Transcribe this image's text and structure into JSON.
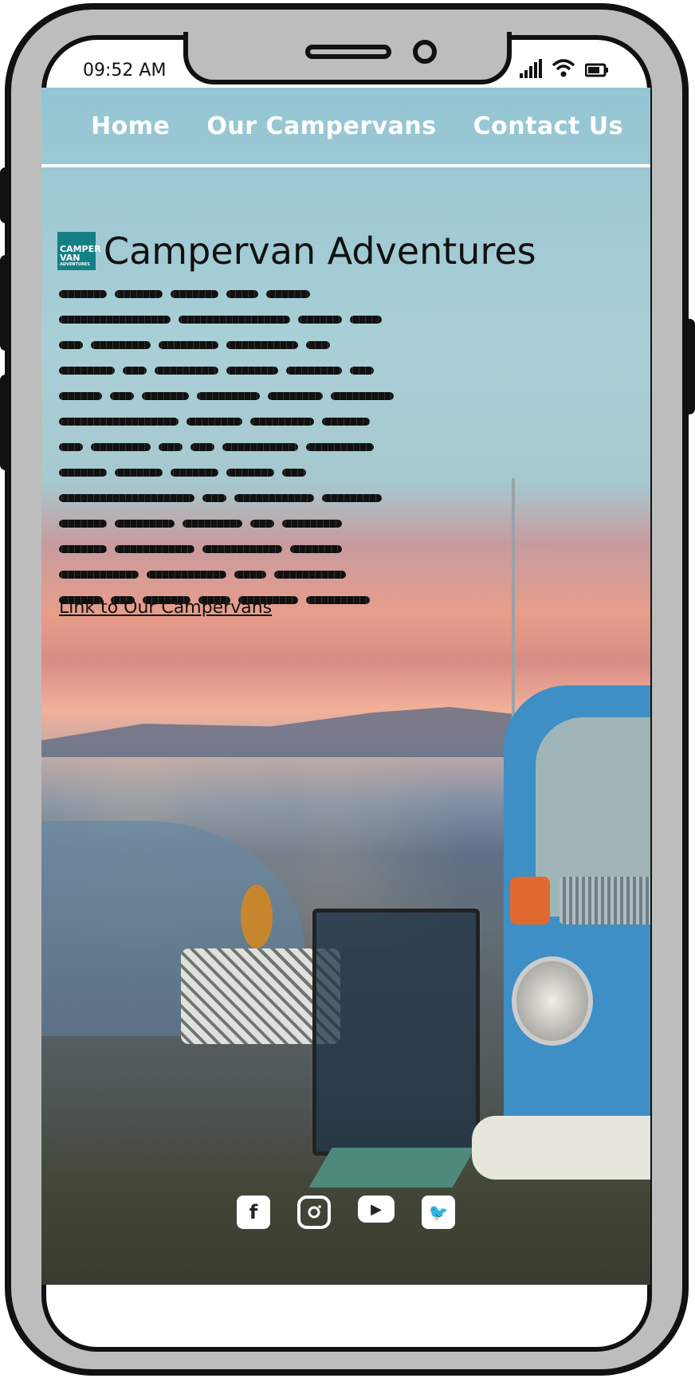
{
  "status": {
    "time": "09:52 AM"
  },
  "nav": {
    "items": [
      "Home",
      "Our Campervans",
      "Contact Us"
    ]
  },
  "brand": {
    "title": "Campervan Adventures",
    "logo_lines": [
      "CAMPER",
      "VAN",
      "ADVENTURES"
    ]
  },
  "hero": {
    "link_text": "Link to Our Campervans"
  },
  "socials": {
    "facebook": "f",
    "instagram": "",
    "youtube": "▶",
    "twitter": "🐦"
  }
}
